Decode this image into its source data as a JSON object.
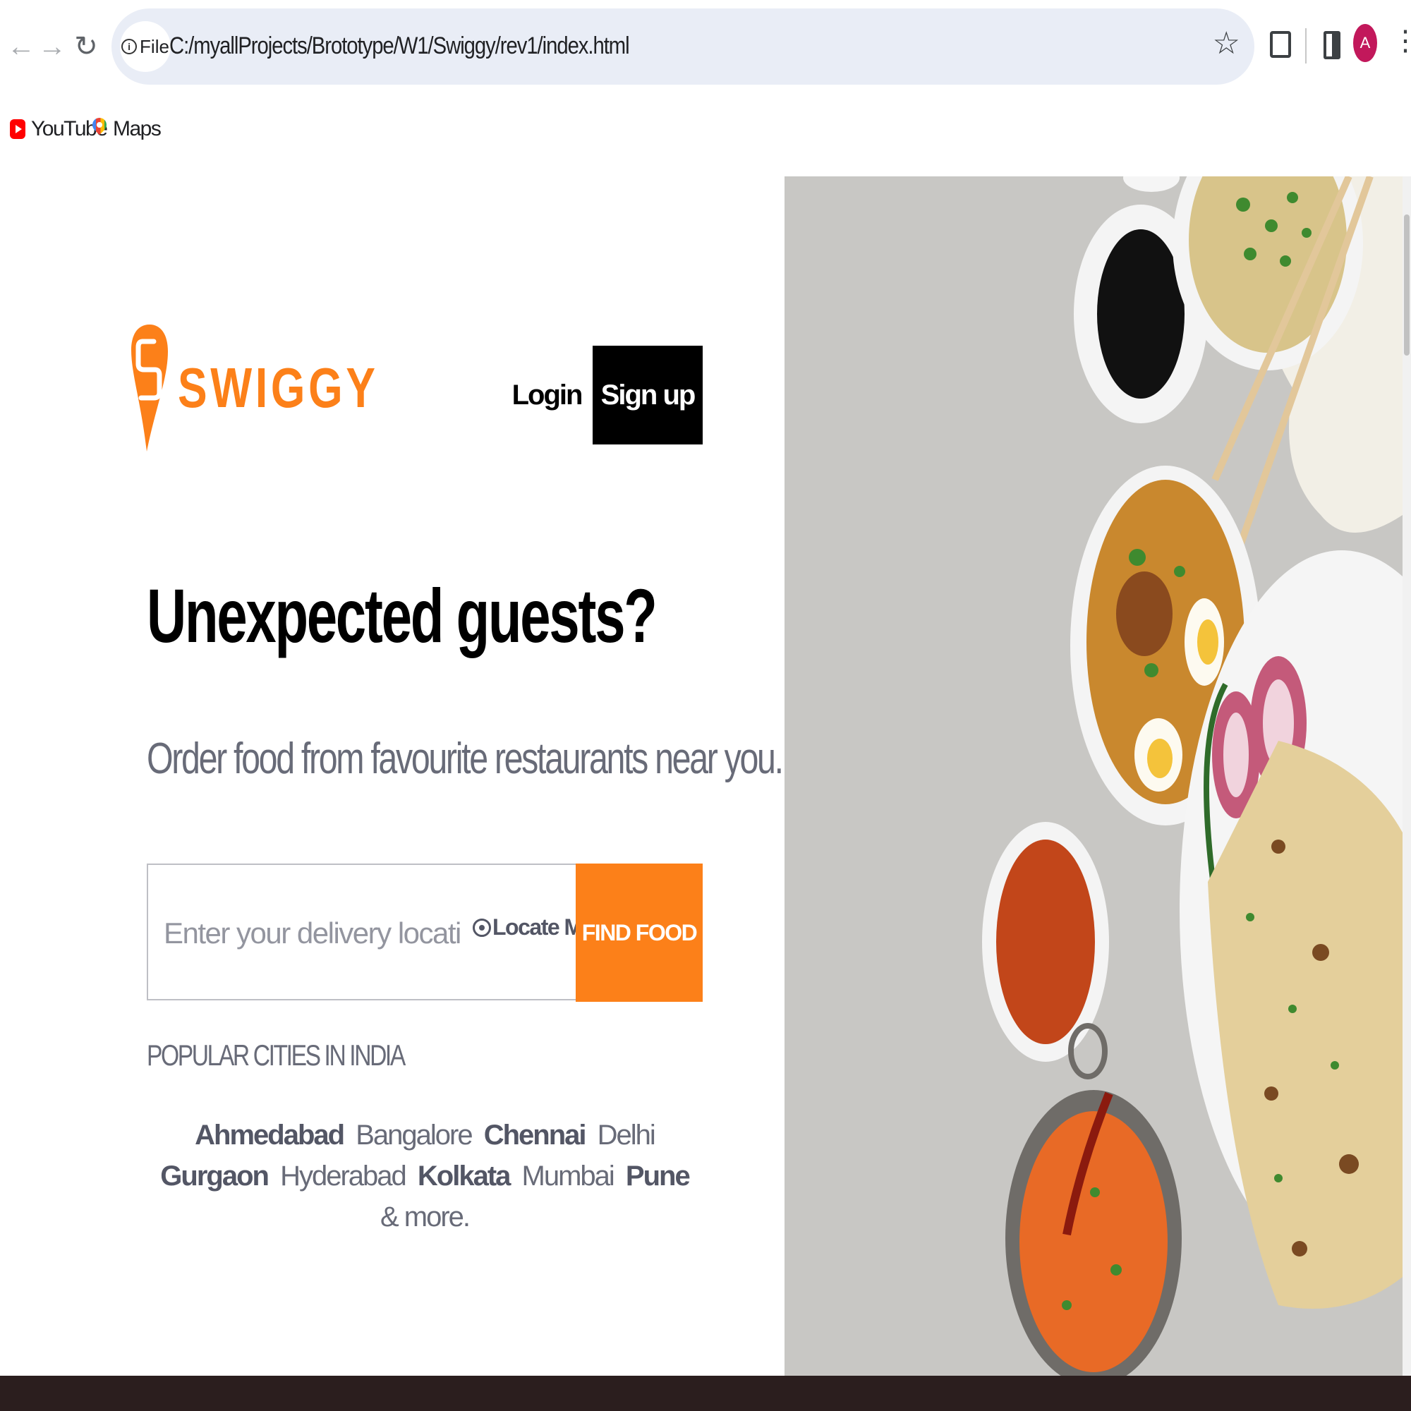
{
  "browser": {
    "url": "C:/myallProjects/Brototype/W1/Swiggy/rev1/index.html",
    "site_info_label": "File",
    "avatar_initial": "A",
    "bookmarks": [
      {
        "label": "YouTube",
        "icon": "youtube-icon"
      },
      {
        "label": "Maps",
        "icon": "maps-icon"
      }
    ]
  },
  "header": {
    "brand": "SWIGGY",
    "login_label": "Login",
    "signup_label": "Sign up"
  },
  "hero": {
    "headline": "Unexpected guests?",
    "subheadline": "Order food from favourite restaurants near you."
  },
  "search": {
    "placeholder": "Enter your delivery location",
    "value": "",
    "locate_label": "Locate Me",
    "find_label": "FIND FOOD"
  },
  "cities": {
    "title": "POPULAR CITIES IN INDIA",
    "items": [
      {
        "name": "Ahmedabad",
        "bold": true
      },
      {
        "name": "Bangalore",
        "bold": false
      },
      {
        "name": "Chennai",
        "bold": true
      },
      {
        "name": "Delhi",
        "bold": false
      },
      {
        "name": "Gurgaon",
        "bold": true
      },
      {
        "name": "Hyderabad",
        "bold": false
      },
      {
        "name": "Kolkata",
        "bold": true
      },
      {
        "name": "Mumbai",
        "bold": false
      },
      {
        "name": "Pune",
        "bold": true
      }
    ],
    "more_label": "& more."
  },
  "colors": {
    "brand_orange": "#fc8019",
    "signup_bg": "#000000",
    "text_gray": "#686b78",
    "footer_bg": "#2b1e1e"
  }
}
